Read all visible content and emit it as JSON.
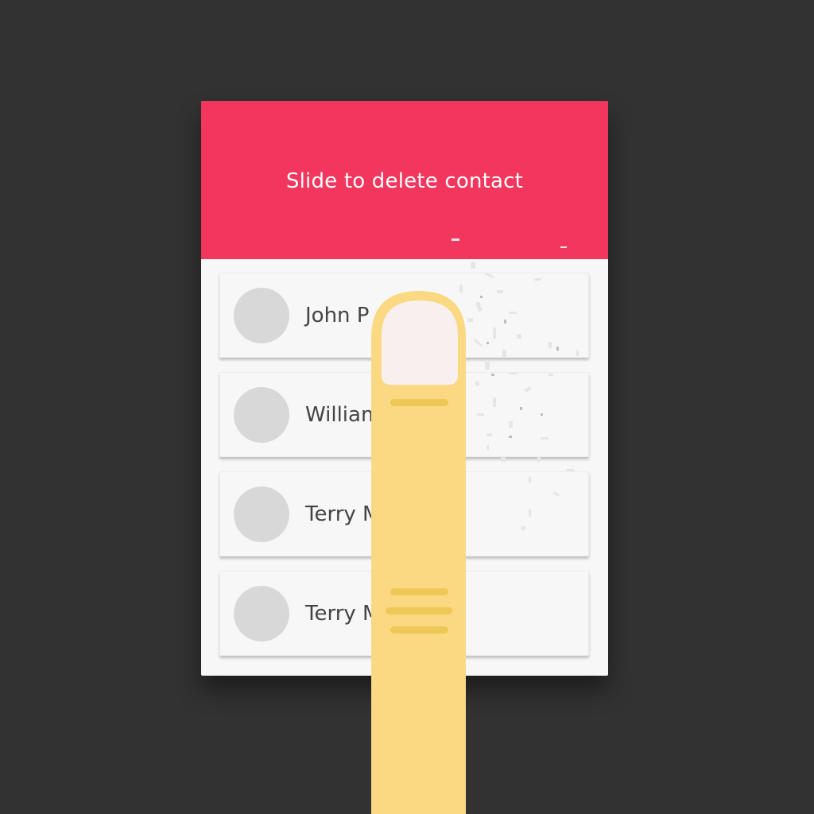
{
  "header": {
    "title": "Slide to delete contact"
  },
  "contacts": [
    {
      "name": "John P"
    },
    {
      "name": "William"
    },
    {
      "name": "Terry M"
    },
    {
      "name": "Terry M"
    }
  ],
  "colors": {
    "background": "#323232",
    "header": "#f2365e",
    "card": "#f7f7f7",
    "avatar": "#d8d8d8",
    "finger": "#fad982",
    "fingernail": "#f8efef"
  },
  "icons": {
    "finger": "pointing-finger-icon"
  }
}
